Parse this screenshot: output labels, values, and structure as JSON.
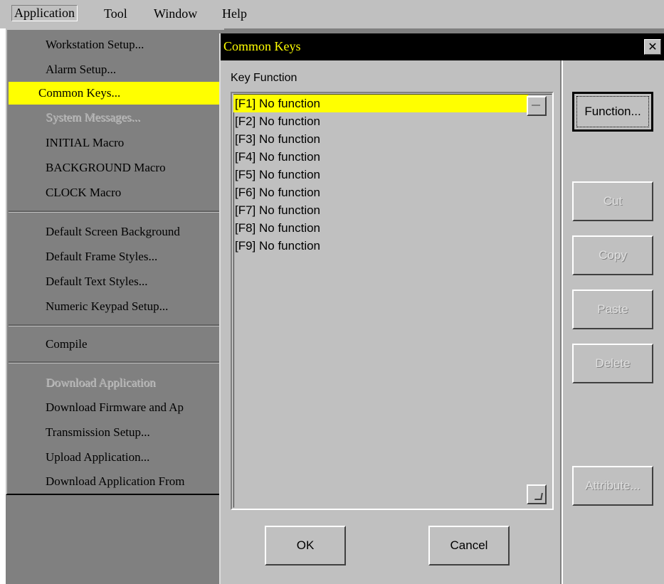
{
  "menubar": {
    "items": [
      "Application",
      "Tool",
      "Window",
      "Help"
    ]
  },
  "application_menu": {
    "items": [
      "Workstation Setup...",
      "Alarm Setup...",
      "Common Keys...",
      "System Messages...",
      "INITIAL Macro",
      "BACKGROUND Macro",
      "CLOCK Macro",
      "Default Screen Background",
      "Default Frame Styles...",
      "Default Text Styles...",
      "Numeric Keypad Setup...",
      "Compile",
      "Download Application",
      "Download Firmware and Ap",
      "Transmission Setup...",
      "Upload Application...",
      "Download Application From"
    ],
    "selected": "Common Keys...",
    "disabled": [
      "System Messages...",
      "Download Application"
    ]
  },
  "dialog": {
    "title": "Common Keys",
    "close_glyph": "✕",
    "list_label": "Key Function",
    "keys": [
      "[F1] No function",
      "[F2] No function",
      "[F3] No function",
      "[F4] No function",
      "[F5] No function",
      "[F6] No function",
      "[F7] No function",
      "[F8] No function",
      "[F9] No function"
    ],
    "buttons": {
      "function": "Function...",
      "cut": "Cut",
      "copy": "Copy",
      "paste": "Paste",
      "delete": "Delete",
      "attribute": "Attribute...",
      "ok": "OK",
      "cancel": "Cancel"
    }
  },
  "colors": {
    "highlight": "#ffff00",
    "dialog_bg": "#c0c0c0",
    "app_bg": "#808080",
    "title_bg": "#000000",
    "title_text": "#ffff00"
  }
}
